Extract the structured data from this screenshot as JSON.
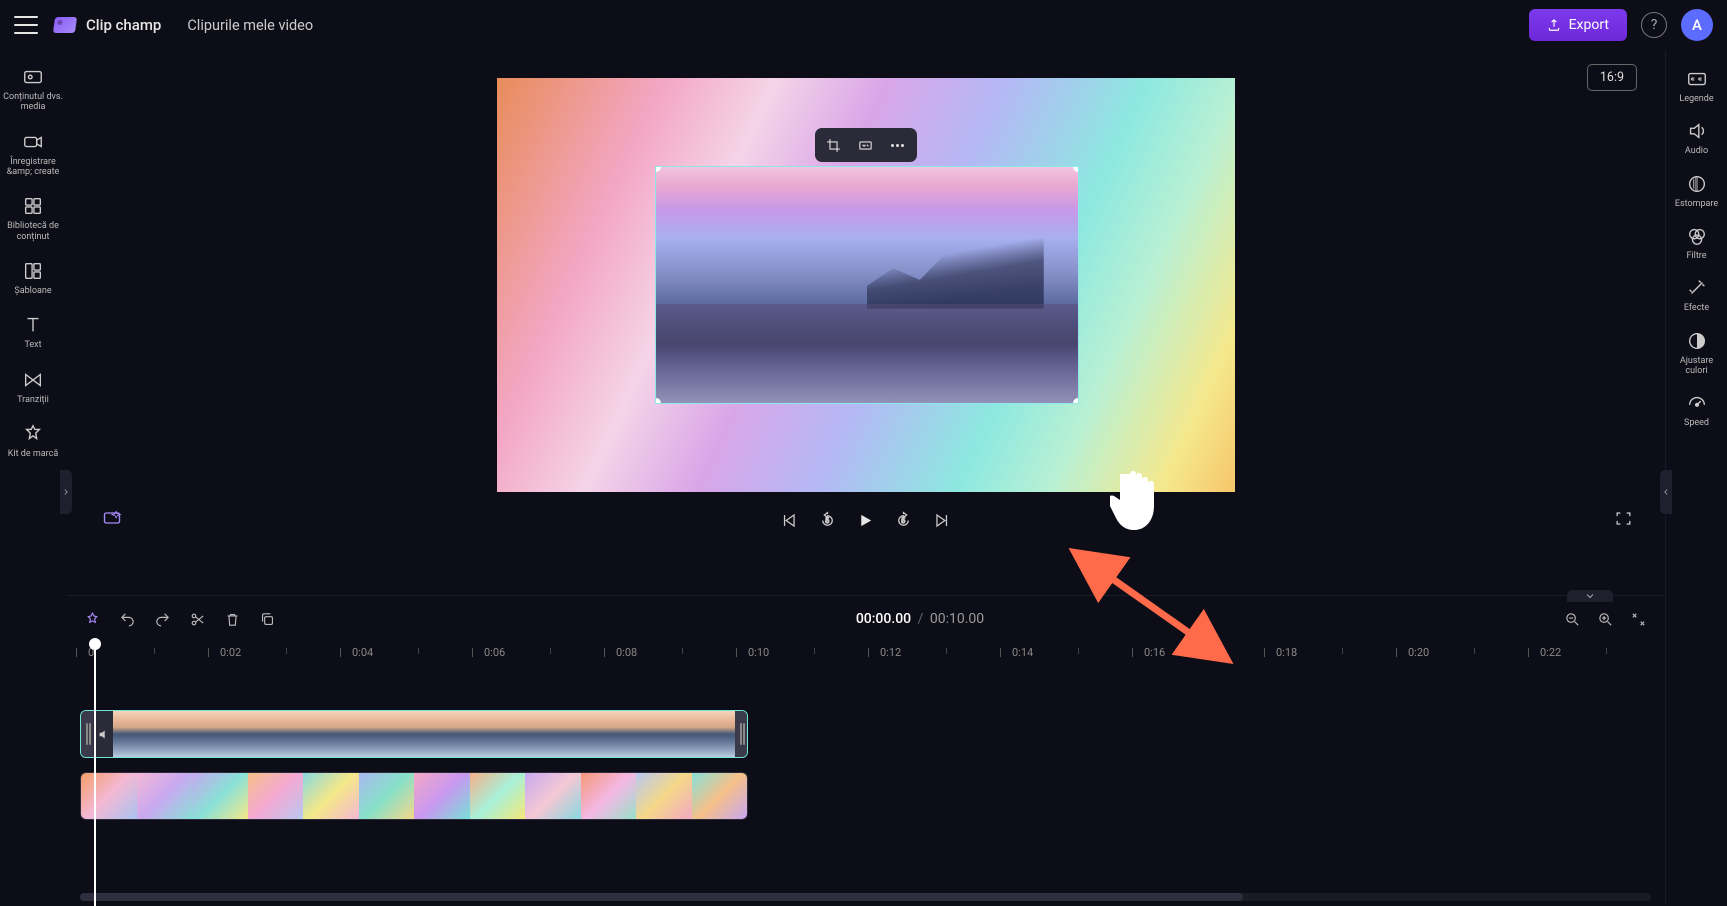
{
  "header": {
    "logo_text": "Clip champ",
    "project_name": "Clipurile mele video",
    "export_label": "Export",
    "help_symbol": "?",
    "avatar_initial": "A"
  },
  "aspect_ratio": "16:9",
  "left_rail": {
    "media": "Conținutul dvs. media",
    "record": "Înregistrare &amp; create",
    "library": "Bibliotecă de conținut",
    "templates": "Șabloane",
    "text": "Text",
    "transitions": "Tranziții",
    "brandkit": "Kit de marcă"
  },
  "right_rail": {
    "captions": "Legende",
    "audio": "Audio",
    "fade": "Estompare",
    "filters": "Filtre",
    "effects": "Efecte",
    "adjust": "Ajustare culori",
    "speed": "Speed"
  },
  "playback": {
    "skip_back": "5",
    "skip_fwd": "5"
  },
  "timecode": {
    "current": "00:00.00",
    "total": "00:10.00"
  },
  "ruler": [
    "0",
    "0:02",
    "0:04",
    "0:06",
    "0:08",
    "0:10",
    "0:12",
    "0:14",
    "0:16",
    "0:18",
    "0:20",
    "0:22"
  ]
}
